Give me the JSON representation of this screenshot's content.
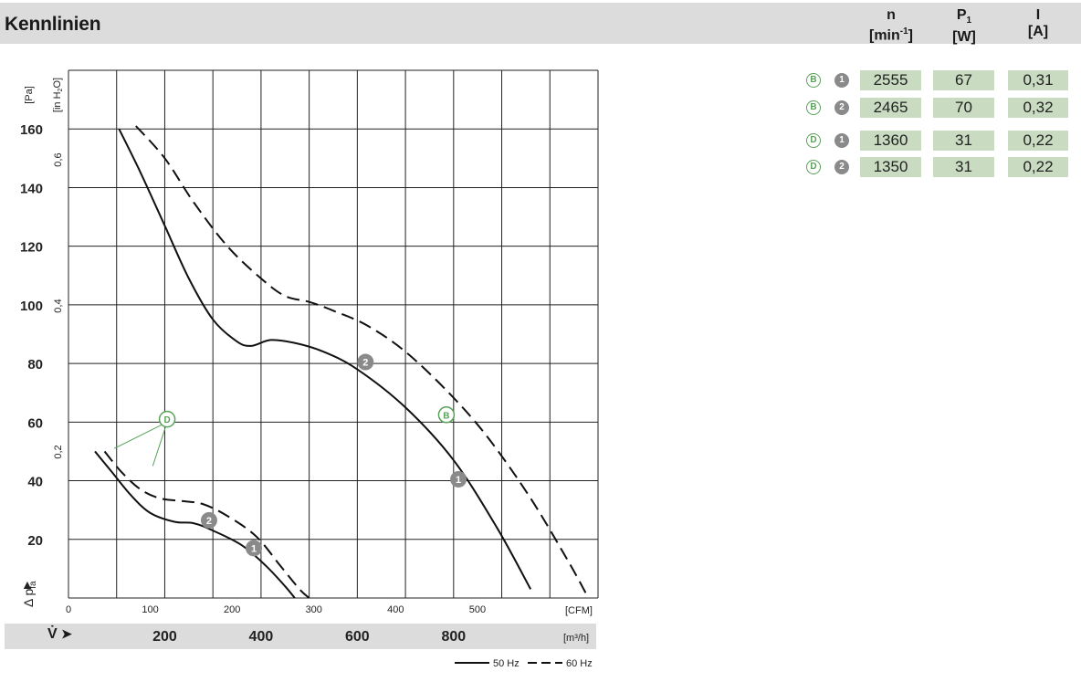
{
  "header": {
    "title": "Kennlinien",
    "col_n": "n",
    "col_n_unit": "[min",
    "col_n_unit_sup": "-1",
    "col_n_unit_end": "]",
    "col_p": "P",
    "col_p_sub": "1",
    "col_p_unit": "[W]",
    "col_i": "I",
    "col_i_unit": "[A]"
  },
  "table": [
    {
      "curve": "B",
      "speed": "1",
      "n": "2555",
      "p": "67",
      "i": "0,31"
    },
    {
      "curve": "B",
      "speed": "2",
      "n": "2465",
      "p": "70",
      "i": "0,32"
    },
    {
      "curve": "D",
      "speed": "1",
      "n": "1360",
      "p": "31",
      "i": "0,22"
    },
    {
      "curve": "D",
      "speed": "2",
      "n": "1350",
      "p": "31",
      "i": "0,22"
    }
  ],
  "chart_data": {
    "type": "line",
    "y_axis_pa": {
      "label": "[Pa]",
      "ticks": [
        "20",
        "40",
        "60",
        "80",
        "100",
        "120",
        "140",
        "160"
      ],
      "range": [
        0,
        180
      ]
    },
    "y_axis_inh2o": {
      "label": "[in H",
      "label_sub": "2",
      "label_end": "O]",
      "ticks": [
        "0,2",
        "0,4",
        "0,6"
      ]
    },
    "x_axis_cfm": {
      "unit": "[CFM]",
      "ticks": [
        "0",
        "100",
        "200",
        "300",
        "400",
        "500"
      ]
    },
    "x_axis_m3h": {
      "unit": "[m³/h]",
      "ticks": [
        "200",
        "400",
        "600",
        "800"
      ],
      "range": [
        0,
        1100
      ]
    },
    "ylabel_symbol": "Δ p",
    "ylabel_sub": "fa",
    "xlabel_symbol": "V̇",
    "grid": true,
    "legend": {
      "solid": "50 Hz",
      "dashed": "60 Hz"
    },
    "labels": {
      "B": "B",
      "D": "D",
      "one": "1",
      "two": "2"
    },
    "series": [
      {
        "curve": "B",
        "freq_hz": 50,
        "points": [
          [
            105,
            160
          ],
          [
            150,
            145
          ],
          [
            200,
            127
          ],
          [
            250,
            109
          ],
          [
            300,
            95
          ],
          [
            350,
            87.5
          ],
          [
            380,
            86
          ],
          [
            420,
            88
          ],
          [
            470,
            87
          ],
          [
            530,
            84
          ],
          [
            600,
            78
          ],
          [
            700,
            65
          ],
          [
            800,
            47
          ],
          [
            890,
            24
          ],
          [
            960,
            3
          ]
        ]
      },
      {
        "curve": "B",
        "freq_hz": 60,
        "points": [
          [
            140,
            161
          ],
          [
            200,
            150
          ],
          [
            260,
            135
          ],
          [
            330,
            120
          ],
          [
            400,
            109
          ],
          [
            450,
            103
          ],
          [
            500,
            101
          ],
          [
            550,
            98
          ],
          [
            620,
            93
          ],
          [
            700,
            84
          ],
          [
            790,
            70
          ],
          [
            870,
            55
          ],
          [
            960,
            34
          ],
          [
            1040,
            12
          ],
          [
            1080,
            0
          ]
        ]
      },
      {
        "curve": "D",
        "freq_hz": 50,
        "points": [
          [
            55,
            50
          ],
          [
            90,
            43
          ],
          [
            130,
            35
          ],
          [
            170,
            29
          ],
          [
            220,
            26
          ],
          [
            260,
            25.5
          ],
          [
            300,
            23
          ],
          [
            360,
            18
          ],
          [
            410,
            11
          ],
          [
            450,
            4
          ],
          [
            470,
            0
          ]
        ]
      },
      {
        "curve": "D",
        "freq_hz": 60,
        "points": [
          [
            75,
            50
          ],
          [
            110,
            43
          ],
          [
            150,
            37
          ],
          [
            190,
            34
          ],
          [
            240,
            33
          ],
          [
            280,
            32
          ],
          [
            330,
            28
          ],
          [
            390,
            21
          ],
          [
            440,
            11
          ],
          [
            480,
            3
          ],
          [
            500,
            0
          ]
        ]
      }
    ]
  }
}
